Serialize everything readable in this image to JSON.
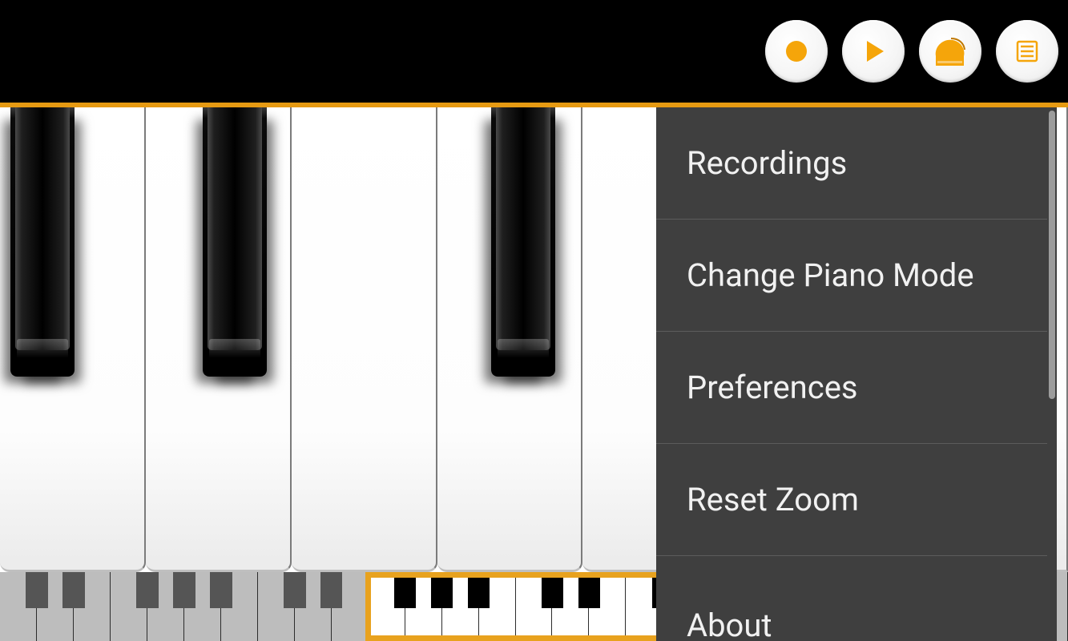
{
  "toolbar": {
    "buttons": [
      {
        "name": "record-button",
        "icon": "record-icon"
      },
      {
        "name": "play-button",
        "icon": "play-icon"
      },
      {
        "name": "instrument-button",
        "icon": "piano-icon"
      },
      {
        "name": "menu-button",
        "icon": "list-icon"
      }
    ]
  },
  "accent_color": "#e8a21e",
  "menu": {
    "items": [
      {
        "label": "Recordings"
      },
      {
        "label": "Change Piano Mode"
      },
      {
        "label": "Preferences"
      },
      {
        "label": "Reset Zoom"
      },
      {
        "label": "About"
      }
    ]
  },
  "piano": {
    "visible_white_keys": 7,
    "black_positions_pct": [
      4,
      22,
      49,
      66,
      84
    ]
  },
  "minimap": {
    "total_white_keys": 29,
    "viewport_start_key": 10,
    "viewport_key_span": 8
  }
}
